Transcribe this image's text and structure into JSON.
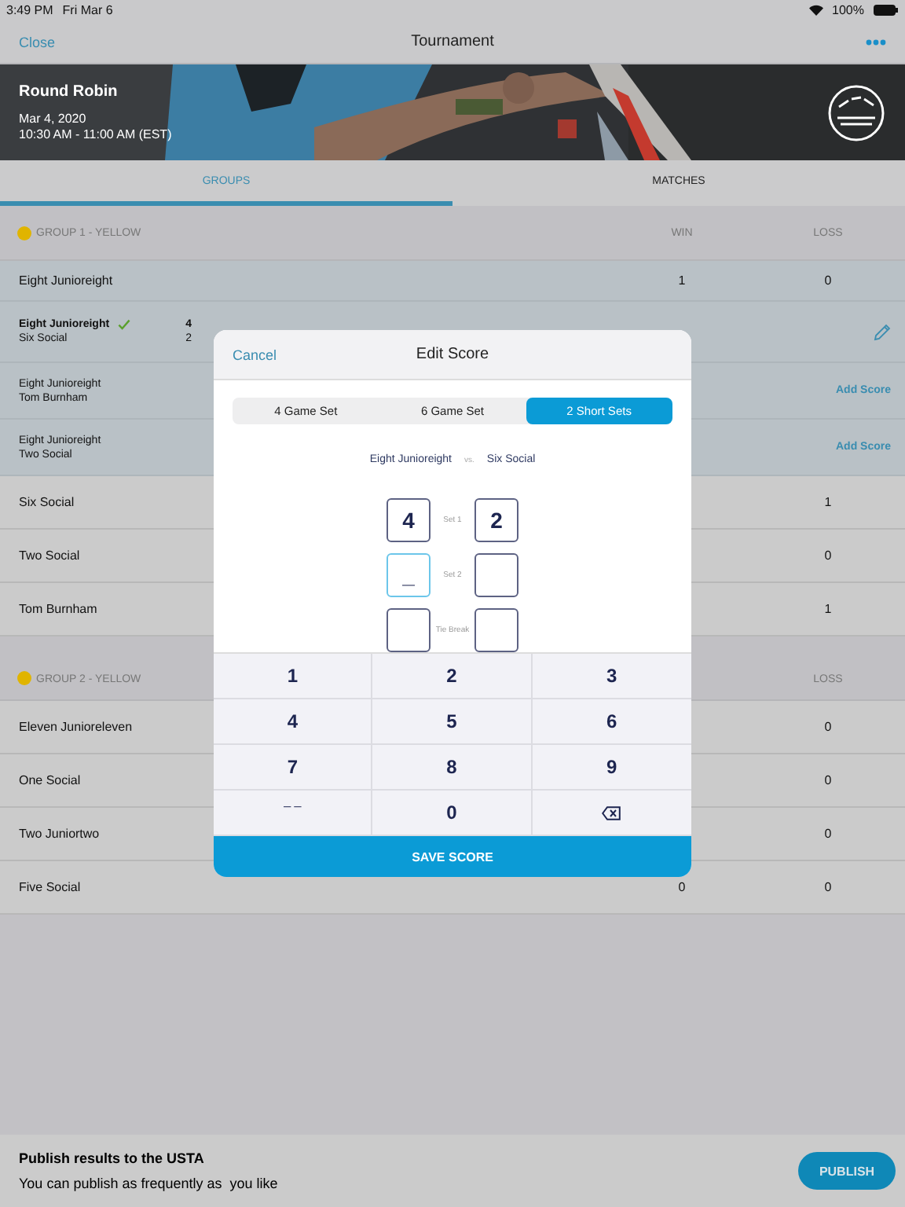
{
  "status_bar": {
    "time": "3:49 PM",
    "date": "Fri Mar 6",
    "battery": "100%"
  },
  "nav": {
    "left": "Close",
    "title": "Tournament"
  },
  "hero": {
    "title": "Round Robin",
    "date": "Mar 4, 2020",
    "time": "10:30 AM - 11:00 AM (EST)"
  },
  "tabs": [
    {
      "label": "GROUPS",
      "selected": true
    },
    {
      "label": "MATCHES",
      "selected": false
    }
  ],
  "groups": [
    {
      "title": "GROUP 1 - YELLOW",
      "color": "#e0b400",
      "win_header": "WIN",
      "loss_header": "LOSS",
      "rows": [
        {
          "kind": "team",
          "name": "Eight Junioreight",
          "win": "1",
          "loss": "0",
          "expanded": true
        },
        {
          "kind": "match",
          "home": "Eight Junioreight",
          "away": "Six Social",
          "home_score": "4",
          "away_score": "2",
          "winner_checked": true,
          "action": {
            "kind": "edit"
          }
        },
        {
          "kind": "match",
          "home": "Eight Junioreight",
          "away": "Tom Burnham",
          "winner_checked": false,
          "action": {
            "kind": "link",
            "label": "Add Score"
          }
        },
        {
          "kind": "match",
          "home": "Eight Junioreight",
          "away": "Two Social",
          "winner_checked": false,
          "action": {
            "kind": "link",
            "label": "Add Score"
          }
        },
        {
          "kind": "team",
          "name": "Six Social",
          "loss": "1",
          "expanded": false
        },
        {
          "kind": "team",
          "name": "Two Social",
          "loss": "0",
          "expanded": false
        },
        {
          "kind": "team",
          "name": "Tom Burnham",
          "loss": "1",
          "expanded": false
        }
      ]
    },
    {
      "title": "GROUP 2 - YELLOW",
      "color": "#e0b400",
      "loss_header": "LOSS",
      "rows": [
        {
          "kind": "team",
          "name": "Eleven Junioreleven",
          "loss": "0",
          "expanded": false
        },
        {
          "kind": "team",
          "name": "One Social",
          "loss": "0",
          "expanded": false
        },
        {
          "kind": "team",
          "name": "Two Juniortwo",
          "loss": "0",
          "expanded": false
        },
        {
          "kind": "team",
          "name": "Five Social",
          "win": "0",
          "loss": "0",
          "expanded": false
        }
      ]
    }
  ],
  "footer": {
    "title": "Publish results to the USTA",
    "text": "You can publish as frequently as  you like",
    "button": "PUBLISH"
  },
  "dialog": {
    "cancel": "Cancel",
    "title": "Edit Score",
    "formats": [
      {
        "label": "4 Game Set",
        "selected": false
      },
      {
        "label": "6 Game Set",
        "selected": false
      },
      {
        "label": "2 Short Sets",
        "selected": true
      }
    ],
    "home": "Eight Junioreight",
    "vs": "vs.",
    "away": "Six Social",
    "sets": [
      {
        "label": "Set 1",
        "home": {
          "value": "4",
          "focused": false
        },
        "away": {
          "value": "2",
          "focused": false
        }
      },
      {
        "label": "Set 2",
        "home": {
          "value": "_",
          "focused": true
        },
        "away": {
          "focused": false
        }
      },
      {
        "label": "Tie Break",
        "home": {
          "focused": false
        },
        "away": {
          "focused": false
        }
      }
    ],
    "keys": [
      {
        "kind": "digit",
        "label": "1"
      },
      {
        "kind": "digit",
        "label": "2"
      },
      {
        "kind": "digit",
        "label": "3"
      },
      {
        "kind": "digit",
        "label": "4"
      },
      {
        "kind": "digit",
        "label": "5"
      },
      {
        "kind": "digit",
        "label": "6"
      },
      {
        "kind": "digit",
        "label": "7"
      },
      {
        "kind": "digit",
        "label": "8"
      },
      {
        "kind": "digit",
        "label": "9"
      },
      {
        "kind": "dash",
        "label": "_ _"
      },
      {
        "kind": "digit",
        "label": "0"
      },
      {
        "kind": "backspace"
      }
    ],
    "save": "SAVE SCORE"
  }
}
